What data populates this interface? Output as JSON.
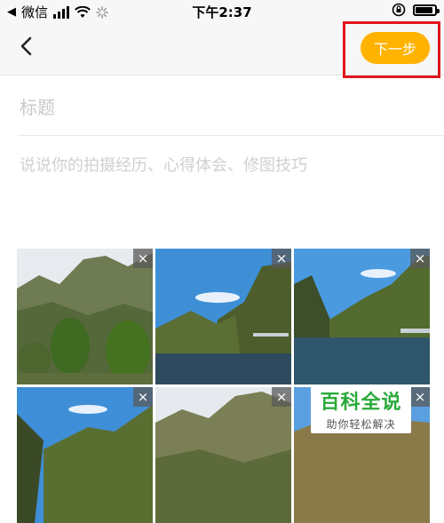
{
  "status_bar": {
    "back_app_label": "微信",
    "time": "下午2:37",
    "icons": [
      "signal-icon",
      "wifi-icon",
      "loading-icon",
      "rotation-lock-icon",
      "battery-icon"
    ],
    "battery_level": 0.9
  },
  "nav": {
    "back_icon": "chevron-left-icon",
    "next_label": "下一步",
    "next_color": "#ffb300",
    "highlight_color": "#e0151c"
  },
  "form": {
    "title_placeholder": "标题",
    "content_placeholder": "说说你的拍摄经历、心得体会、修图技巧"
  },
  "photos": {
    "remove_label": "×",
    "count": 6
  },
  "watermark": {
    "title": "百科全说",
    "subtitle": "助你轻松解决"
  }
}
